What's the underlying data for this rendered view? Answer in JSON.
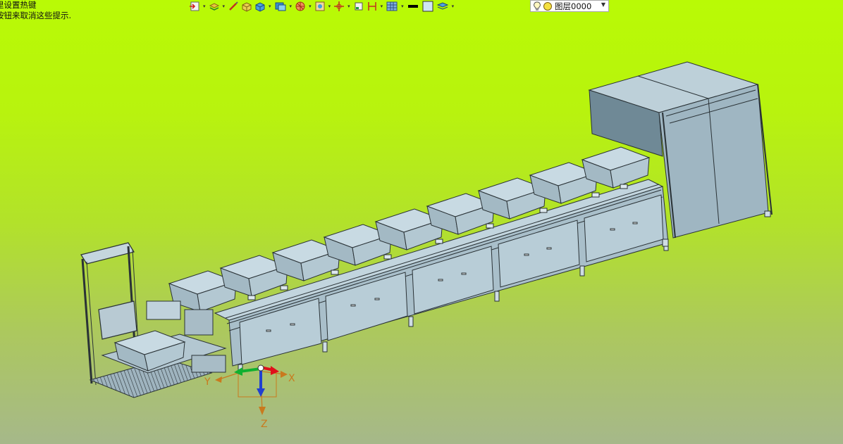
{
  "hint": {
    "line1": "里设置热键",
    "line2": "按钮来取消这些提示."
  },
  "toolbar": {
    "icons": [
      "open-icon",
      "layers-icon",
      "sketch-icon",
      "solid-icon",
      "box-icon",
      "view-icon",
      "render-icon",
      "frame-icon",
      "target-icon",
      "snap-icon",
      "measure-icon",
      "grid-icon",
      "line-color-icon",
      "fill-color-icon",
      "style-icon"
    ],
    "layer": {
      "name": "图层0000"
    }
  },
  "axes": {
    "x": "X",
    "y": "Y",
    "z": "Z"
  },
  "colors": {
    "bg_top": "#b9fa05",
    "bg_bottom": "#a6b88a",
    "model_face": "#b4c8d2",
    "model_edge": "#2a3236",
    "axis_orange": "#c97a1e",
    "axis_x": "#e0101a",
    "axis_y": "#10b030",
    "axis_z": "#2040d0"
  }
}
